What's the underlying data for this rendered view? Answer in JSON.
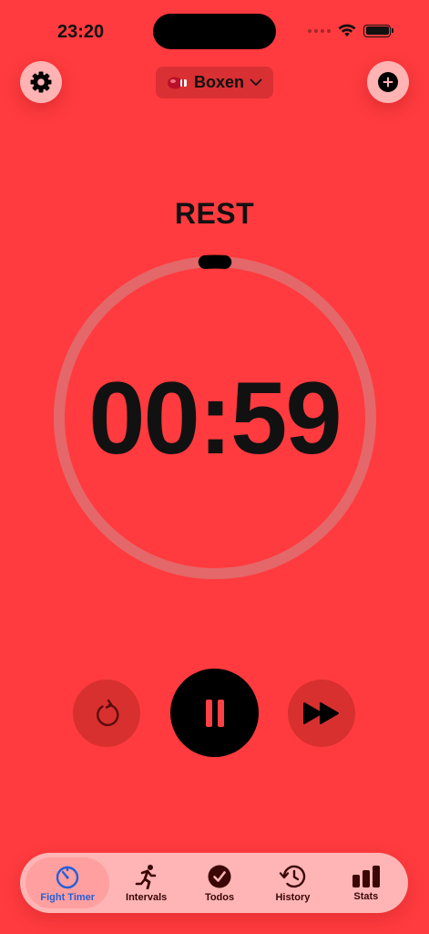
{
  "status_bar": {
    "time": "23:20"
  },
  "header": {
    "sport_label": "Boxen",
    "settings_icon": "gear-icon",
    "add_icon": "plus-circle-icon",
    "sport_icon": "boxing-glove-icon"
  },
  "timer": {
    "phase": "REST",
    "time": "00:59",
    "progress": 0.02
  },
  "controls": {
    "reset_icon": "reset-icon",
    "pause_icon": "pause-icon",
    "skip_icon": "skip-forward-icon"
  },
  "tabs": [
    {
      "label": "Fight Timer",
      "icon": "timer-icon",
      "active": true
    },
    {
      "label": "Intervals",
      "icon": "running-icon",
      "active": false
    },
    {
      "label": "Todos",
      "icon": "checkmark-circle-icon",
      "active": false
    },
    {
      "label": "History",
      "icon": "history-icon",
      "active": false
    },
    {
      "label": "Stats",
      "icon": "bar-chart-icon",
      "active": false
    }
  ],
  "colors": {
    "background": "#ff3b3f",
    "accent": "#2460d8",
    "ring_track": "#e4686a"
  }
}
